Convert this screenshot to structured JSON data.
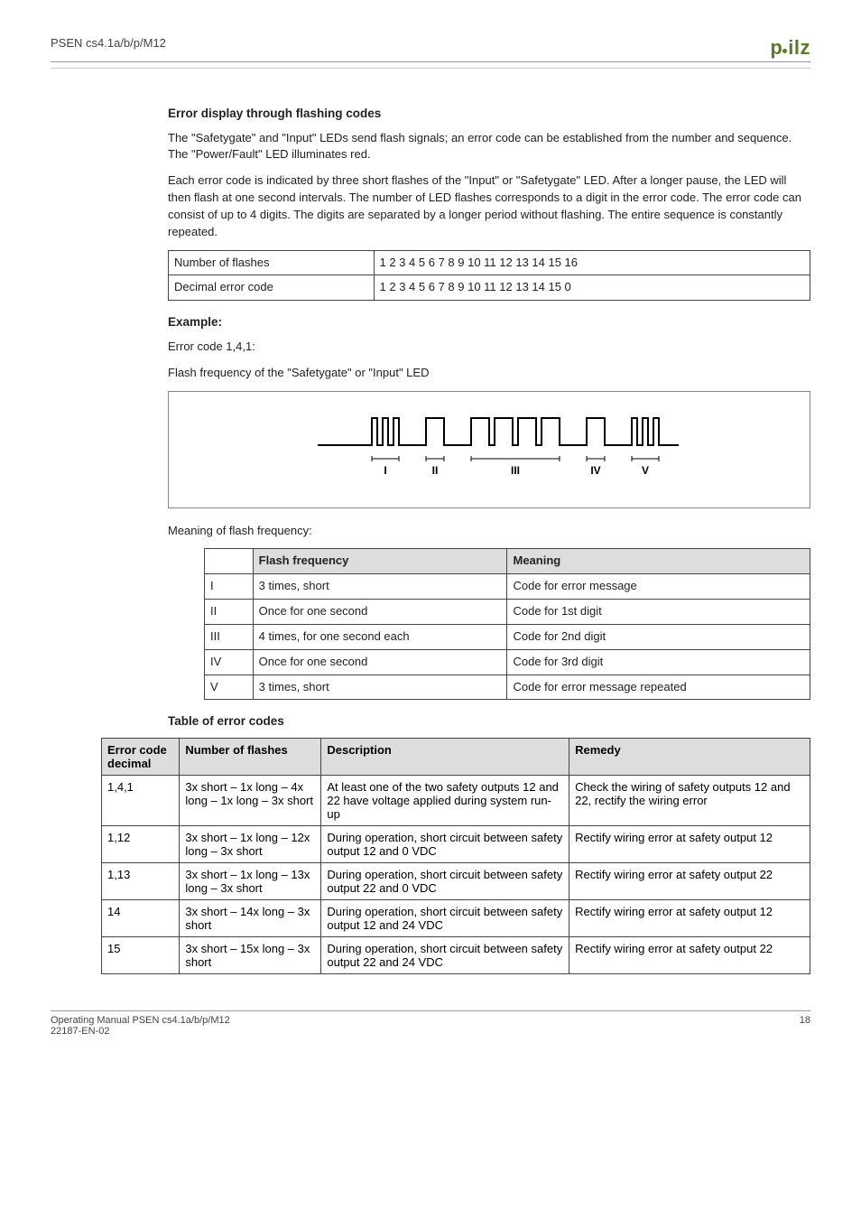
{
  "header": {
    "product": "PSEN cs4.1a/b/p/M12",
    "logo": "pilz"
  },
  "section1": {
    "title": "Error display through flashing codes",
    "para1": "The \"Safetygate\" and \"Input\" LEDs send flash signals; an error code can be established from the number and sequence. The \"Power/Fault\" LED illuminates red.",
    "para2": "Each error code is indicated by three short flashes of the \"Input\" or \"Safetygate\" LED. After a longer pause, the LED will then flash at one second intervals. The number of LED flashes corresponds to a digit in the error code. The error code can consist of up to 4 digits. The digits are separated by a longer period without flashing. The entire sequence is constantly repeated."
  },
  "flash_table": {
    "rows": [
      {
        "label": "Number of flashes",
        "value": "1 2 3 4 5 6 7 8 9 10 11 12 13 14 15 16"
      },
      {
        "label": "Decimal error code",
        "value": "1 2 3 4 5 6 7 8 9 10 11 12 13 14 15 0"
      }
    ]
  },
  "example": {
    "title": "Example:",
    "line1": "Error code 1,4,1:",
    "line2": "Flash frequency of the \"Safetygate\" or \"Input\" LED"
  },
  "waveform_labels": {
    "I": "I",
    "II": "II",
    "III": "III",
    "IV": "IV",
    "V": "V"
  },
  "meaning": {
    "title": "Meaning of flash frequency:",
    "headers": {
      "col1": "",
      "col2": "Flash frequency",
      "col3": "Meaning"
    },
    "rows": [
      {
        "num": "I",
        "freq": "3 times, short",
        "meaning": "Code for error message"
      },
      {
        "num": "II",
        "freq": "Once for one second",
        "meaning": "Code for 1st digit"
      },
      {
        "num": "III",
        "freq": "4 times, for one second each",
        "meaning": "Code for 2nd digit"
      },
      {
        "num": "IV",
        "freq": "Once for one second",
        "meaning": "Code for 3rd digit"
      },
      {
        "num": "V",
        "freq": "3 times, short",
        "meaning": "Code for error message repeated"
      }
    ]
  },
  "errors": {
    "title": "Table of error codes",
    "headers": {
      "col1a": "Error code",
      "col1b": "decimal",
      "col2": "Number of flashes",
      "col3": "Description",
      "col4": "Remedy"
    },
    "rows": [
      {
        "code": "1,4,1",
        "flashes": "3x short – 1x long – 4x long – 1x long – 3x short",
        "desc": "At least one of the two safety outputs 12 and 22 have voltage applied during system run-up",
        "remedy": "Check the wiring of safety outputs 12 and 22, rectify the wiring error"
      },
      {
        "code": "1,12",
        "flashes": "3x short – 1x long – 12x long – 3x short",
        "desc": "During operation, short circuit between safety output 12 and 0 VDC",
        "remedy": "Rectify wiring error at safety output 12"
      },
      {
        "code": "1,13",
        "flashes": "3x short – 1x long – 13x long – 3x short",
        "desc": "During operation, short circuit between safety output 22 and 0 VDC",
        "remedy": "Rectify wiring error at safety output 22"
      },
      {
        "code": "14",
        "flashes": "3x short – 14x long – 3x short",
        "desc": "During operation, short circuit between safety output 12 and 24 VDC",
        "remedy": "Rectify wiring error at safety output 12"
      },
      {
        "code": "15",
        "flashes": "3x short – 15x long – 3x short",
        "desc": "During operation, short circuit between safety output 22 and 24 VDC",
        "remedy": "Rectify wiring error at safety output 22"
      }
    ]
  },
  "footer": {
    "left1": "Operating Manual PSEN cs4.1a/b/p/M12",
    "left2": "22187-EN-02",
    "page": "18"
  }
}
